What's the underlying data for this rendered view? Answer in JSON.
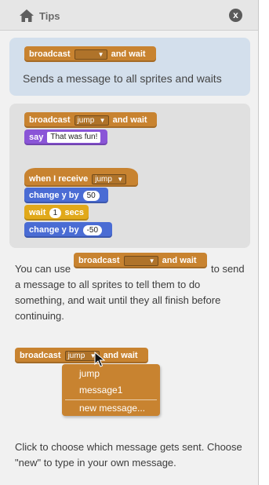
{
  "header": {
    "title": "Tips",
    "close_label": "x",
    "home_icon": "home-icon",
    "close_icon": "close-icon"
  },
  "summary_card": {
    "block": {
      "prefix": "broadcast",
      "menu_value": "",
      "suffix": "and wait"
    },
    "description": "Sends a message to all sprites and waits"
  },
  "example_card": {
    "broadcast_block": {
      "prefix": "broadcast",
      "menu_value": "jump",
      "suffix": "and wait"
    },
    "say_block": {
      "prefix": "say",
      "text": "That was fun!"
    },
    "hat_block": {
      "prefix": "when I receive",
      "menu_value": "jump"
    },
    "change_y_1": {
      "prefix": "change y by",
      "value": "50"
    },
    "wait_block": {
      "prefix": "wait",
      "value": "1",
      "suffix": "secs"
    },
    "change_y_2": {
      "prefix": "change y by",
      "value": "-50"
    }
  },
  "explanation": {
    "line1_before": "You can use",
    "line1_after": "to send",
    "line2": "a message to all sprites to tell them to do",
    "line3": "something, and wait until they all finish before",
    "line4": "continuing.",
    "inline_block": {
      "prefix": "broadcast",
      "menu_value": "",
      "suffix": "and wait"
    }
  },
  "menu_demo": {
    "block": {
      "prefix": "broadcast",
      "menu_value": "jump",
      "suffix": "and wait"
    },
    "options": [
      "jump",
      "message1",
      "new message..."
    ]
  },
  "footer_text": {
    "line1": "Click to choose which message gets sent. Choose",
    "line2": "\"new\" to type in your own message."
  },
  "colors": {
    "events": "#c88330",
    "looks": "#8a55d7",
    "motion": "#4a6cd4",
    "control": "#e1a91a",
    "tip_card": "#d3dfec"
  }
}
